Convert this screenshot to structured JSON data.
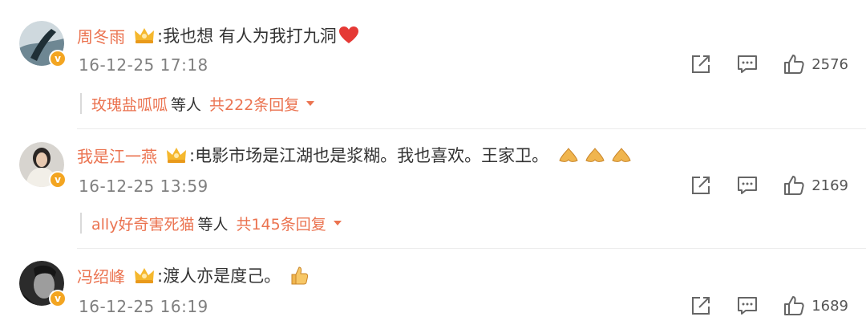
{
  "comments": [
    {
      "username": "周冬雨",
      "text": ":我也想 有人为我打九洞",
      "emoji": "heart",
      "time": "16-12-25 17:18",
      "likes": "2576",
      "replies": {
        "names": "玫瑰盐呱呱",
        "etc": "等人",
        "total": "共222条回复"
      }
    },
    {
      "username": "我是江一燕",
      "text": ":电影市场是江湖也是浆糊。我也喜欢。王家卫。",
      "emoji": "pray-hands",
      "time": "16-12-25 13:59",
      "likes": "2169",
      "replies": {
        "names": "ally好奇害死猫",
        "etc": "等人",
        "total": "共145条回复"
      }
    },
    {
      "username": "冯绍峰",
      "text": ":渡人亦是度己。",
      "emoji": "thumbs-up",
      "time": "16-12-25 16:19",
      "likes": "1689"
    }
  ],
  "colors": {
    "username": "#eb7350",
    "text": "#333333",
    "meta": "#808080",
    "badge": "#f3a521"
  },
  "icons": {
    "verified": "v",
    "share": "share-icon",
    "reply": "comment-icon",
    "like": "thumbs-up-icon",
    "expand": "caret-down-icon"
  }
}
